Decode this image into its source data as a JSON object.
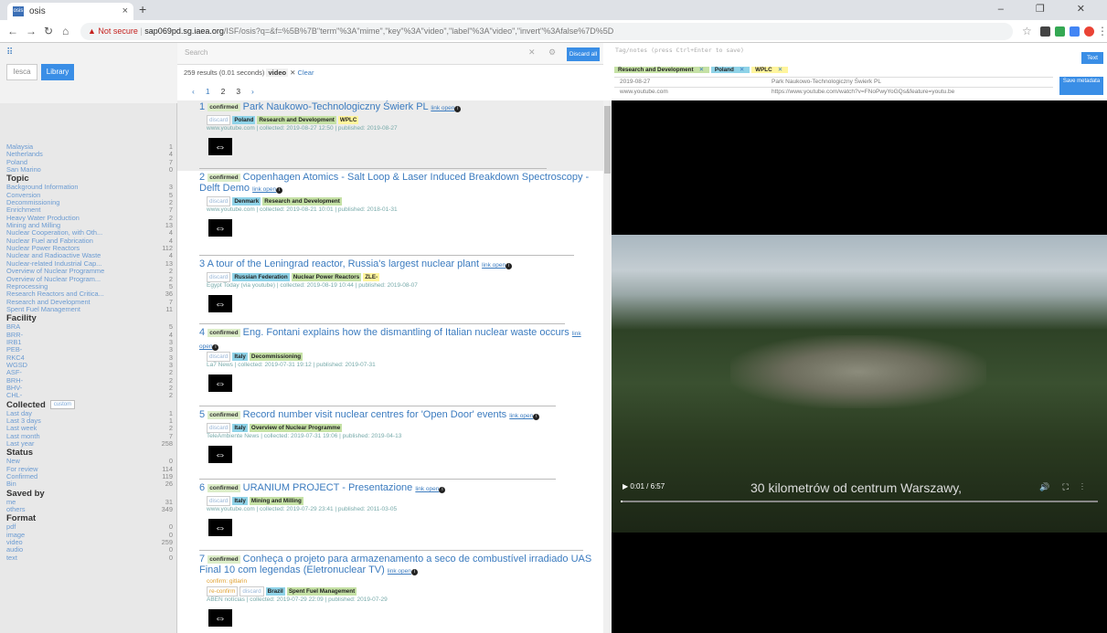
{
  "browser": {
    "tab_title": "osis",
    "tab_icon": "osis",
    "new_tab": "+",
    "close_tab": "×",
    "window_controls": "–  ❐  ✕",
    "security": "▲ Not secure",
    "url_domain": "sap069pd.sg.iaea.org",
    "url_path": "/ISF/osis?q=&f=%5B%7B\"term\"%3A\"mime\",\"key\"%3A\"video\",\"label\"%3A\"video\",\"invert\"%3Afalse%7D%5D"
  },
  "left": {
    "grid_icon": "⠿",
    "iesca": "Iesca",
    "library": "Library",
    "country_items": [
      {
        "label": "Malaysia",
        "count": "1"
      },
      {
        "label": "Netherlands",
        "count": "4"
      },
      {
        "label": "Poland",
        "count": "7"
      },
      {
        "label": "San Marino",
        "count": "0"
      }
    ],
    "topic_heading": "Topic",
    "topic_items": [
      {
        "label": "Background Information",
        "count": "3"
      },
      {
        "label": "Conversion",
        "count": "5"
      },
      {
        "label": "Decommissioning",
        "count": "2"
      },
      {
        "label": "Enrichment",
        "count": "7"
      },
      {
        "label": "Heavy Water Production",
        "count": "2"
      },
      {
        "label": "Mining and Milling",
        "count": "13"
      },
      {
        "label": "Nuclear Cooperation, with Oth...",
        "count": "4"
      },
      {
        "label": "Nuclear Fuel and Fabrication",
        "count": "4"
      },
      {
        "label": "Nuclear Power Reactors",
        "count": "112"
      },
      {
        "label": "Nuclear and Radioactive Waste",
        "count": "4"
      },
      {
        "label": "Nuclear-related Industrial Cap...",
        "count": "13"
      },
      {
        "label": "Overview of Nuclear Programme",
        "count": "2"
      },
      {
        "label": "Overview of Nuclear Program...",
        "count": "2"
      },
      {
        "label": "Reprocessing",
        "count": "5"
      },
      {
        "label": "Research Reactors and Critica...",
        "count": "36"
      },
      {
        "label": "Research and Development",
        "count": "7"
      },
      {
        "label": "Spent Fuel Management",
        "count": "11"
      }
    ],
    "facility_heading": "Facility",
    "facility_items": [
      {
        "label": "BRA",
        "count": "5"
      },
      {
        "label": "BRR-",
        "count": "4"
      },
      {
        "label": "IRB1",
        "count": "3"
      },
      {
        "label": "PEB-",
        "count": "3"
      },
      {
        "label": "RKC4",
        "count": "3"
      },
      {
        "label": "WGSD",
        "count": "3"
      },
      {
        "label": "ASF-",
        "count": "2"
      },
      {
        "label": "BRH-",
        "count": "2"
      },
      {
        "label": "BHV-",
        "count": "2"
      },
      {
        "label": "CHL-",
        "count": "2"
      }
    ],
    "collected_heading": "Collected",
    "collected_custom": "custom",
    "collected_items": [
      {
        "label": "Last day",
        "count": "1"
      },
      {
        "label": "Last 3 days",
        "count": "1"
      },
      {
        "label": "Last week",
        "count": "2"
      },
      {
        "label": "Last month",
        "count": "7"
      },
      {
        "label": "Last year",
        "count": "258"
      }
    ],
    "status_heading": "Status",
    "status_items": [
      {
        "label": "New",
        "count": "0"
      },
      {
        "label": "For review",
        "count": "114"
      },
      {
        "label": "Confirmed",
        "count": "119"
      },
      {
        "label": "Bin",
        "count": "26"
      }
    ],
    "savedby_heading": "Saved by",
    "savedby_items": [
      {
        "label": "me",
        "count": "31"
      },
      {
        "label": "others",
        "count": "349"
      }
    ],
    "format_heading": "Format",
    "format_items": [
      {
        "label": "pdf",
        "count": "0"
      },
      {
        "label": "image",
        "count": "0"
      },
      {
        "label": "video",
        "count": "259"
      },
      {
        "label": "audio",
        "count": "0"
      },
      {
        "label": "text",
        "count": "0"
      }
    ]
  },
  "results": {
    "search_placeholder": "Search",
    "discard_all": "Discard all",
    "count_text": "259 results (0.01 seconds)",
    "active_filter": "video",
    "clear": "Clear",
    "pager": [
      "‹",
      "1",
      "2",
      "3",
      "›"
    ],
    "items": [
      {
        "num": "1",
        "status": "confirmed",
        "title": "Park Naukowo-Technologiczny Świerk PL",
        "link": "link open",
        "tags": [
          {
            "t": "discard",
            "k": "disc"
          },
          {
            "t": "Poland",
            "k": "country"
          },
          {
            "t": "Research and Development",
            "k": "topic"
          },
          {
            "t": "WPLC",
            "k": "fac"
          }
        ],
        "source": "www.youtube.com | collected: 2019-08-27 12:50 | published: 2019-08-27"
      },
      {
        "num": "2",
        "status": "confirmed",
        "title": "Copenhagen Atomics - Salt Loop & Laser Induced Breakdown Spectroscopy - Delft Demo",
        "link": "link open",
        "tags": [
          {
            "t": "discard",
            "k": "disc"
          },
          {
            "t": "Denmark",
            "k": "country"
          },
          {
            "t": "Research and Development",
            "k": "topic"
          }
        ],
        "source": "www.youtube.com | collected: 2019-08-21 10:01 | published: 2018-01-31"
      },
      {
        "num": "3",
        "status": "",
        "title": "A tour of the Leningrad reactor, Russia's largest nuclear plant",
        "link": "link open",
        "tags": [
          {
            "t": "discard",
            "k": "disc"
          },
          {
            "t": "Russian Federation",
            "k": "country"
          },
          {
            "t": "Nuclear Power Reactors",
            "k": "topic"
          },
          {
            "t": "ZLE-",
            "k": "fac"
          }
        ],
        "source": "Egypt Today (via youtube) | collected: 2019-08-19 10:44 | published: 2019-08-07"
      },
      {
        "num": "4",
        "status": "confirmed",
        "title": "Eng. Fontani explains how the dismantling of Italian nuclear waste occurs",
        "link": "link open",
        "tags": [
          {
            "t": "discard",
            "k": "disc"
          },
          {
            "t": "Italy",
            "k": "country"
          },
          {
            "t": "Decommissioning",
            "k": "topic"
          }
        ],
        "source": "La7 News | collected: 2019-07-31 19:12 | published: 2019-07-31"
      },
      {
        "num": "5",
        "status": "confirmed",
        "title": "Record number visit nuclear centres for 'Open Door' events",
        "link": "link open",
        "tags": [
          {
            "t": "discard",
            "k": "disc"
          },
          {
            "t": "Italy",
            "k": "country"
          },
          {
            "t": "Overview of Nuclear Programme",
            "k": "topic"
          }
        ],
        "source": "TeleAmbiente News | collected: 2019-07-31 19:06 | published: 2019-04-13"
      },
      {
        "num": "6",
        "status": "confirmed",
        "title": "URANIUM PROJECT - Presentazione",
        "link": "link open",
        "tags": [
          {
            "t": "discard",
            "k": "disc"
          },
          {
            "t": "Italy",
            "k": "country"
          },
          {
            "t": "Mining and Milling",
            "k": "topic"
          }
        ],
        "source": "www.youtube.com | collected: 2019-07-29 23:41 | published: 2011-03-05"
      },
      {
        "num": "7",
        "status": "confirmed",
        "title": "Conheça o projeto para armazenamento a seco de combustível irradiado UAS Final 10 com legendas (Eletronuclear TV)",
        "link": "link open",
        "confirm_by": "confirm: gitlarin",
        "tags": [
          {
            "t": "re-confirm",
            "k": "reconf"
          },
          {
            "t": "discard",
            "k": "disc"
          },
          {
            "t": "Brazil",
            "k": "country"
          },
          {
            "t": "Spent Fuel Management",
            "k": "topic"
          }
        ],
        "source": "ABEN notícias | collected: 2019-07-29 22:09 | published: 2019-07-29"
      }
    ]
  },
  "right": {
    "notes_placeholder": "Tag/notes (press Ctrl+Enter to save)",
    "text_button": "Text",
    "tags": [
      {
        "t": "Research and Development",
        "k": "topic"
      },
      {
        "t": "Poland",
        "k": "country"
      },
      {
        "t": "WPLC",
        "k": "fac"
      }
    ],
    "meta_rows": [
      {
        "a": "2019-08-27",
        "b": "Park Naukowo-Technologiczny Świerk PL"
      },
      {
        "a": "www.youtube.com",
        "b": "https://www.youtube.com/watch?v=FNoPwyYoGQs&feature=youtu.be"
      }
    ],
    "save_metadata": "Save metadata",
    "video_time": "0:01 / 6:57",
    "video_progress": 0.003,
    "caption": "30 kilometrów od centrum Warszawy,"
  }
}
